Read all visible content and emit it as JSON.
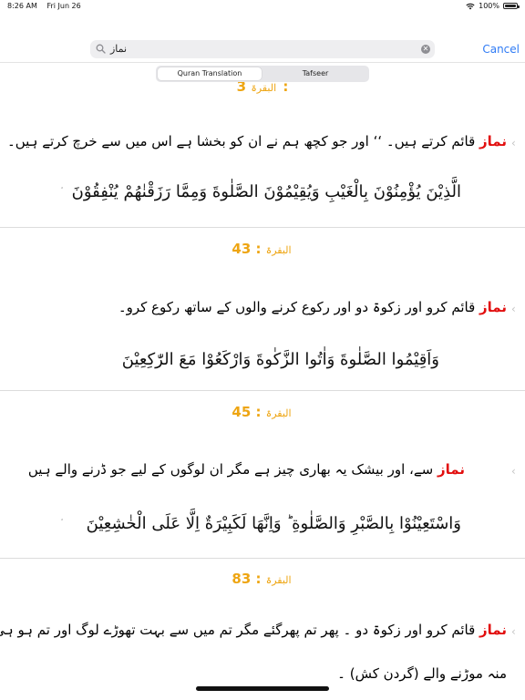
{
  "status_bar": {
    "time": "8:26 AM",
    "date": "Fri Jun 26",
    "battery_text": "100%",
    "battery_level": 1.0
  },
  "search": {
    "query": "نماز",
    "cancel_label": "Cancel"
  },
  "tabs": [
    {
      "label": "Quran Translation",
      "selected": true
    },
    {
      "label": "Tafseer",
      "selected": false
    }
  ],
  "results": [
    {
      "surah": "البقرۃ",
      "ayah": "3",
      "keyword": "نماز",
      "translation_lines": [
        "قائم کرتے ہیں۔ ‘‘ اور جو کچھ ہم نے ان کو بخشا ہے اس میں سے خرچ کرتے ہیں۔"
      ],
      "arabic": "الَّذِيْنَ يُؤْمِنُوْنَ بِالْغَيْبِ وَيُقِيْمُوْنَ الصَّلٰوةَ وَمِمَّا رَزَقْنٰهُمْ يُنْفِقُوْنَ"
    },
    {
      "surah": "البقرۃ",
      "ayah": "43",
      "keyword": "نماز",
      "translation_lines": [
        "قائم کرو اور زکوۃ دو اور رکوع کرنے والوں کے ساتھ رکوع کرو۔"
      ],
      "arabic": "وَاَقِيْمُوا الصَّلٰوةَ وَاٰتُوا الزَّكٰوةَ وَارْكَعُوْا مَعَ الرّٰكِعِيْنَ"
    },
    {
      "surah": "البقرۃ",
      "ayah": "45",
      "keyword": "نماز",
      "translation_lines": [
        "سے، اور بیشک یہ بھاری چیز ہے مگر ان لوگوں کے لیے جو ڈرنے والے ہیں"
      ],
      "arabic": "وَاسْتَعِيْنُوْا بِالصَّبْرِ وَالصَّلٰوةِ ؕ وَاِنَّهَا لَكَبِيْرَةٌ اِلَّا عَلَى الْخٰشِعِيْنَ"
    },
    {
      "surah": "البقرۃ",
      "ayah": "83",
      "keyword": "نماز",
      "translation_lines": [
        "قائم کرو اور زکوۃ دو ۔ پھر تم پھرگئے مگر تم میں سے بہت تھوڑے لوگ اور تم ہو ہی",
        "منہ موڑنے والے (گردن کش) ۔"
      ],
      "arabic": ""
    }
  ]
}
